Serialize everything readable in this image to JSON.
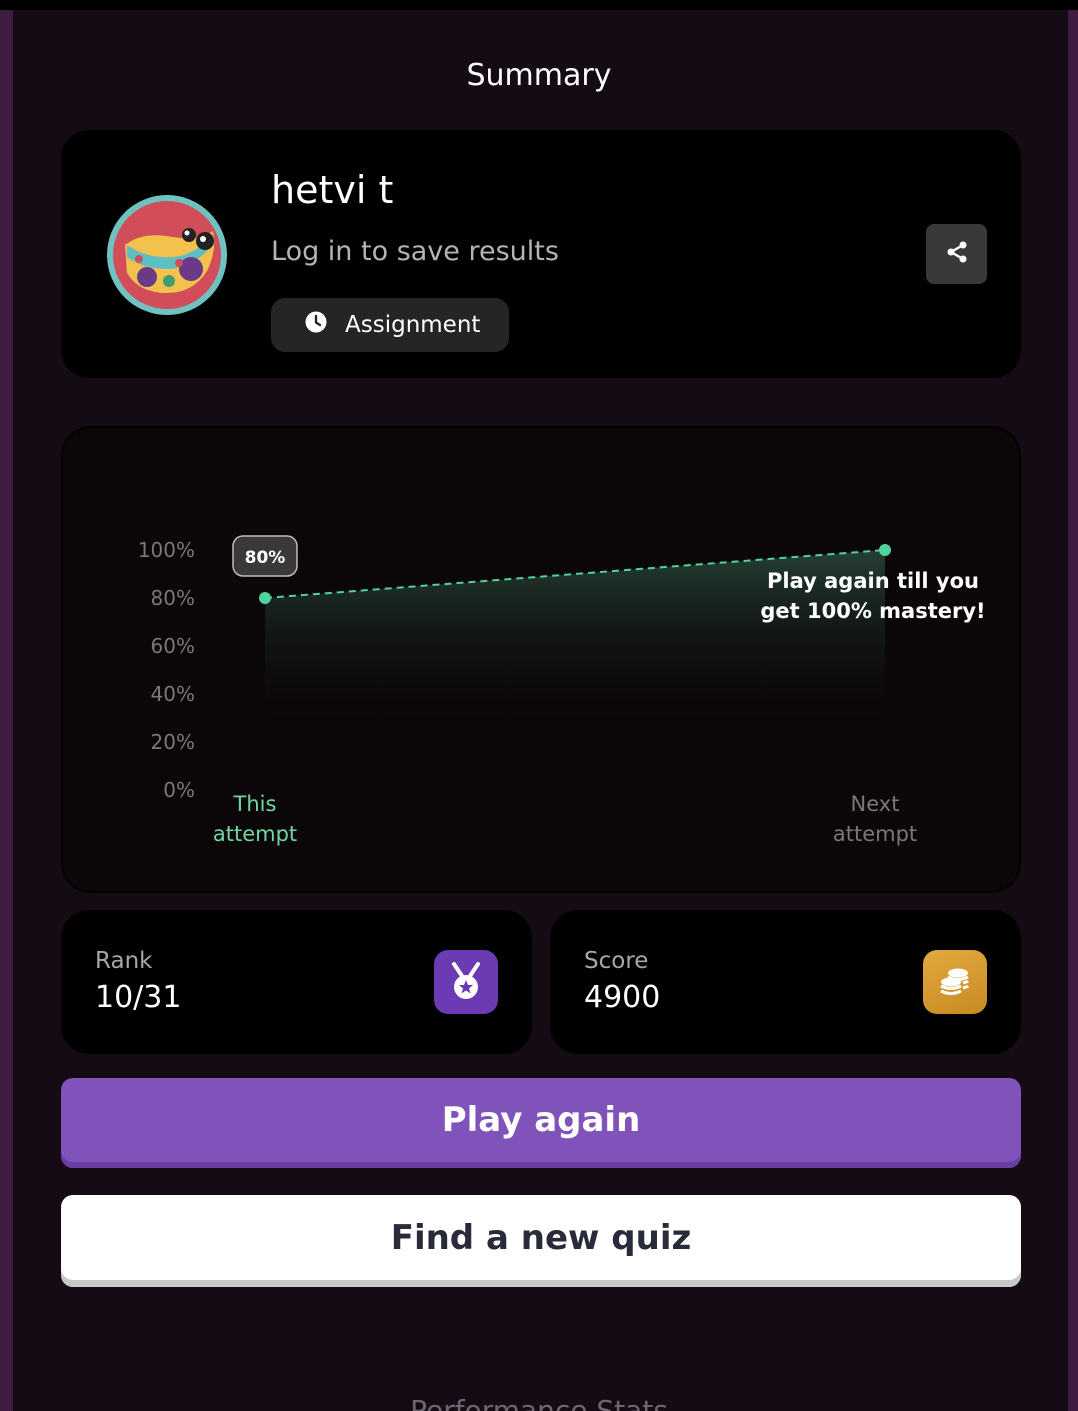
{
  "header": {
    "title": "Summary"
  },
  "profile": {
    "name": "hetvi t",
    "login_prompt": "Log in to save results",
    "mode_label": "Assignment",
    "avatar_icon": "cheetah-mascot-icon",
    "share_icon": "share-icon"
  },
  "chart_data": {
    "type": "area",
    "categories": [
      "This\nattempt",
      "Next\nattempt"
    ],
    "values": [
      80,
      100
    ],
    "y_ticks": [
      "100%",
      "80%",
      "60%",
      "40%",
      "20%",
      "0%"
    ],
    "ylim": [
      0,
      100
    ],
    "data_label": "80%",
    "annotation": "Play again till you get 100% mastery!",
    "grid": false,
    "colors": {
      "line": "#4fd39a",
      "label_active": "#6fd7a3",
      "label_inactive": "#7b767b"
    }
  },
  "stats": {
    "rank": {
      "label": "Rank",
      "value": "10/31",
      "icon": "medal-icon"
    },
    "score": {
      "label": "Score",
      "value": "4900",
      "icon": "coins-icon"
    }
  },
  "actions": {
    "play_again": "Play again",
    "find_quiz": "Find a new quiz"
  },
  "footer": {
    "section_title": "Performance Stats"
  },
  "colors": {
    "accent_purple": "#8053ba",
    "rank_icon_bg": "#6b3bb4",
    "coin_icon_bg": "#d89a30"
  }
}
